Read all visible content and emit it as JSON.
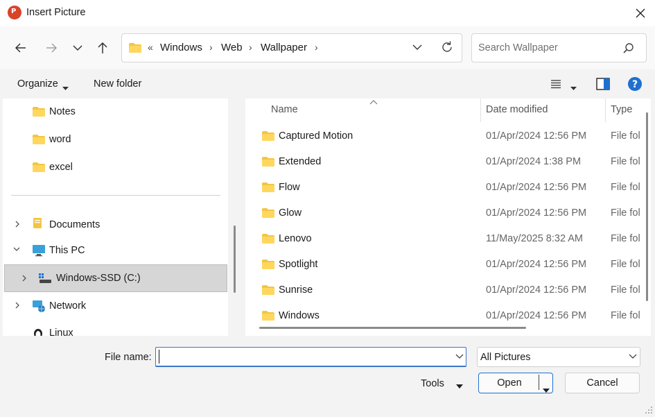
{
  "window": {
    "title": "Insert Picture",
    "app_badge": "P"
  },
  "address": {
    "overflow": "«",
    "crumbs": [
      "Windows",
      "Web",
      "Wallpaper"
    ]
  },
  "search": {
    "placeholder": "Search Wallpaper"
  },
  "toolbar": {
    "organize": "Organize",
    "new_folder": "New folder"
  },
  "nav": {
    "quick": [
      {
        "label": "Notes"
      },
      {
        "label": "word"
      },
      {
        "label": "excel"
      }
    ],
    "documents": "Documents",
    "this_pc": "This PC",
    "drive": "Windows-SSD (C:)",
    "network": "Network",
    "linux": "Linux"
  },
  "columns": {
    "name": "Name",
    "date": "Date modified",
    "type": "Type"
  },
  "files": [
    {
      "name": "Captured Motion",
      "date": "01/Apr/2024 12:56 PM",
      "type": "File fol"
    },
    {
      "name": "Extended",
      "date": "01/Apr/2024 1:38 PM",
      "type": "File fol"
    },
    {
      "name": "Flow",
      "date": "01/Apr/2024 12:56 PM",
      "type": "File fol"
    },
    {
      "name": "Glow",
      "date": "01/Apr/2024 12:56 PM",
      "type": "File fol"
    },
    {
      "name": "Lenovo",
      "date": "11/May/2025 8:32 AM",
      "type": "File fol"
    },
    {
      "name": "Spotlight",
      "date": "01/Apr/2024 12:56 PM",
      "type": "File fol"
    },
    {
      "name": "Sunrise",
      "date": "01/Apr/2024 12:56 PM",
      "type": "File fol"
    },
    {
      "name": "Windows",
      "date": "01/Apr/2024 12:56 PM",
      "type": "File fol"
    }
  ],
  "bottom": {
    "file_name_label": "File name:",
    "file_name_value": "",
    "filter": "All Pictures",
    "tools": "Tools",
    "open": "Open",
    "cancel": "Cancel"
  },
  "colors": {
    "accent": "#0067c0",
    "folder": "#f4c542",
    "selected": "#d6d6d6"
  }
}
